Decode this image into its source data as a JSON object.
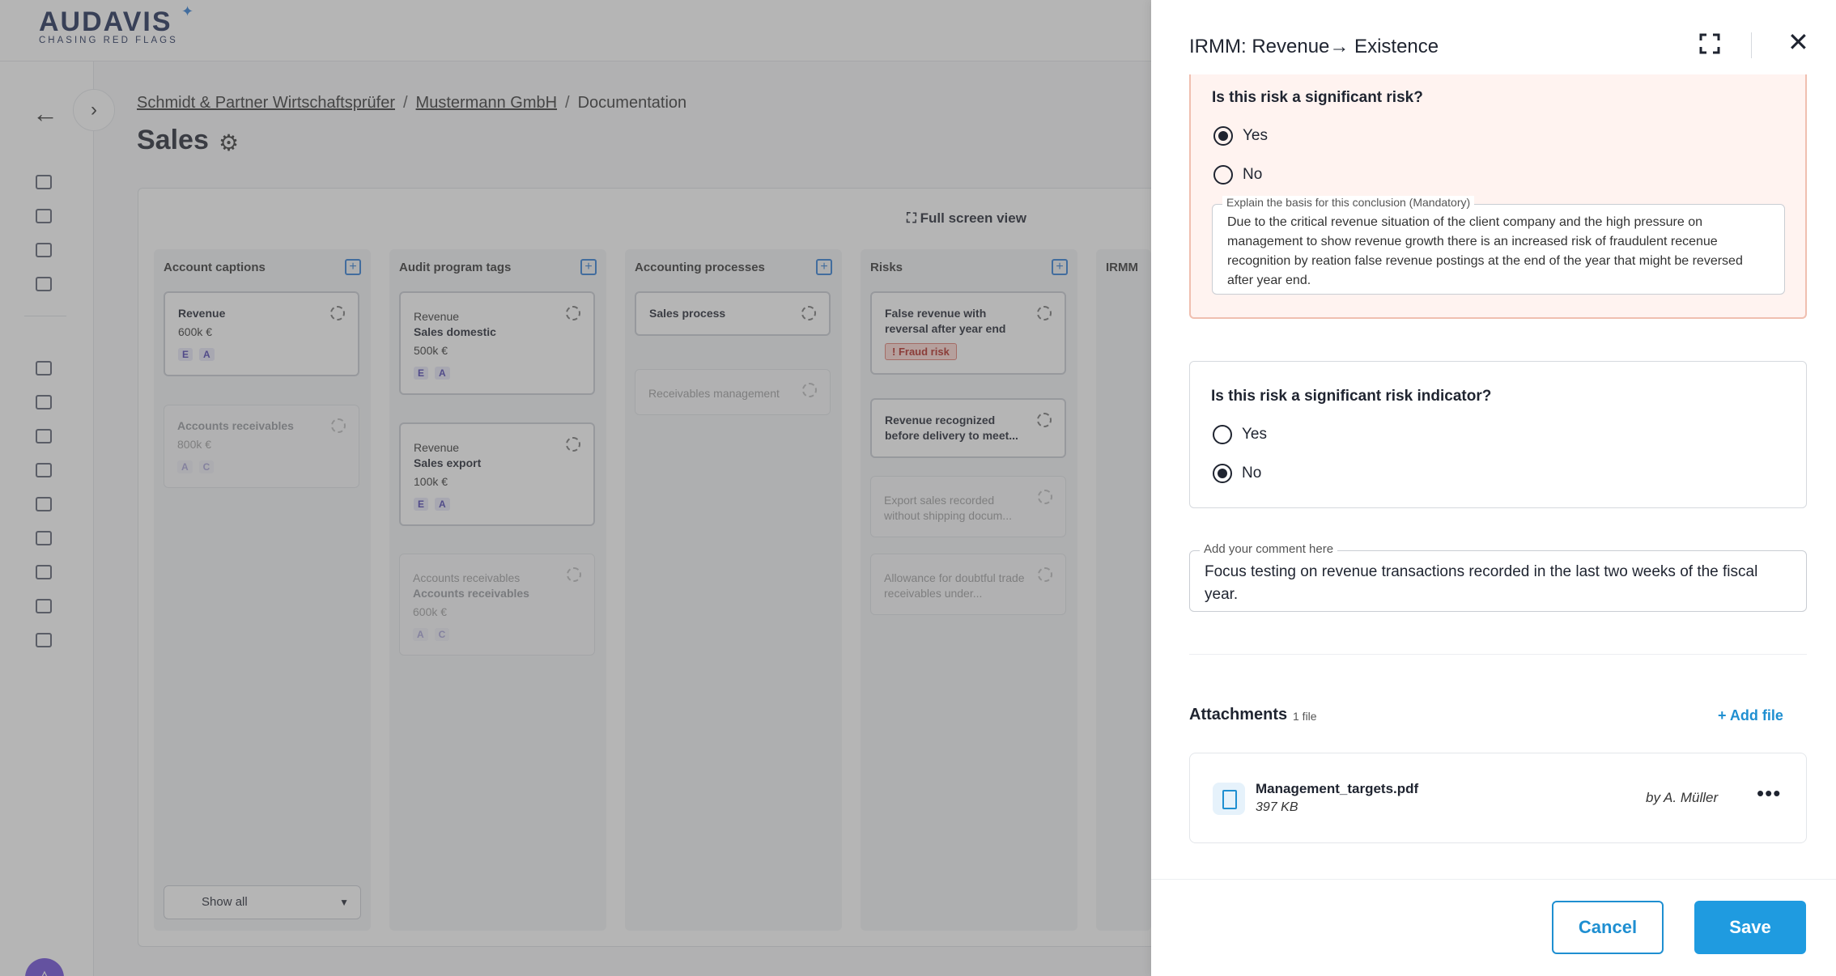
{
  "logo": {
    "main": "AUDAVIS",
    "sub": "CHASING RED FLAGS"
  },
  "breadcrumb": {
    "firm": "Schmidt & Partner Wirtschaftsprüfer",
    "client": "Mustermann GmbH",
    "section": "Documentation",
    "sep": "/"
  },
  "page_title": "Sales",
  "board": {
    "full_screen_label": "Full screen view",
    "show_all_label": "Show all",
    "columns": [
      {
        "title": "Account captions",
        "cards": [
          {
            "title": "Revenue",
            "sub": "600k €",
            "tags": [
              "E",
              "A"
            ]
          },
          {
            "title": "Accounts receivables",
            "sub": "800k €",
            "tags": [
              "A",
              "C"
            ]
          }
        ]
      },
      {
        "title": "Audit program tags",
        "cards": [
          {
            "title": "Revenue",
            "sub": "Sales domestic",
            "amount": "500k €",
            "tags": [
              "E",
              "A"
            ]
          },
          {
            "title": "Revenue",
            "sub": "Sales export",
            "amount": "100k €",
            "tags": [
              "E",
              "A"
            ]
          },
          {
            "title": "Accounts receivables",
            "sub": "Accounts receivables",
            "amount": "600k €",
            "tags": [
              "A",
              "C"
            ]
          }
        ]
      },
      {
        "title": "Accounting processes",
        "cards": [
          {
            "title": "Sales process"
          },
          {
            "title": "Receivables management"
          }
        ]
      },
      {
        "title": "Risks",
        "cards": [
          {
            "title": "False revenue with reversal after year end",
            "badge": "! Fraud risk"
          },
          {
            "title": "Revenue recognized before delivery to meet..."
          },
          {
            "title": "Export sales recorded without shipping docum..."
          },
          {
            "title": "Allowance for doubtful trade receivables under..."
          }
        ]
      },
      {
        "title": "IRMM"
      }
    ]
  },
  "panel": {
    "title": "IRMM: Revenue→ Existence",
    "q1": {
      "question": "Is this risk a significant risk?",
      "options": [
        "Yes",
        "No"
      ],
      "selected": "Yes",
      "explain_label": "Explain the basis for this conclusion (Mandatory)",
      "explain_text": "Due to the critical revenue situation of the client company and the high pressure on management to show revenue growth there is an increased risk of fraudulent recenue recognition by reation false revenue postings at the end of the year that might be reversed after year end."
    },
    "q2": {
      "question": "Is this risk a significant risk indicator?",
      "options": [
        "Yes",
        "No"
      ],
      "selected": "No"
    },
    "comment": {
      "label": "Add your comment here",
      "text": "Focus testing on revenue transactions recorded in the last two weeks of the fiscal year."
    },
    "attachments": {
      "title": "Attachments",
      "count": "1 file",
      "add_label": "+ Add file",
      "files": [
        {
          "name": "Management_targets.pdf",
          "size": "397 KB",
          "owner": "by A. Müller"
        }
      ]
    },
    "cancel_label": "Cancel",
    "save_label": "Save"
  },
  "colors": {
    "accent": "#1f9be0",
    "warning_bg": "#fff3f0",
    "fraud_badge": "#ffd9d4",
    "ai_button": "#6c4bd9"
  }
}
